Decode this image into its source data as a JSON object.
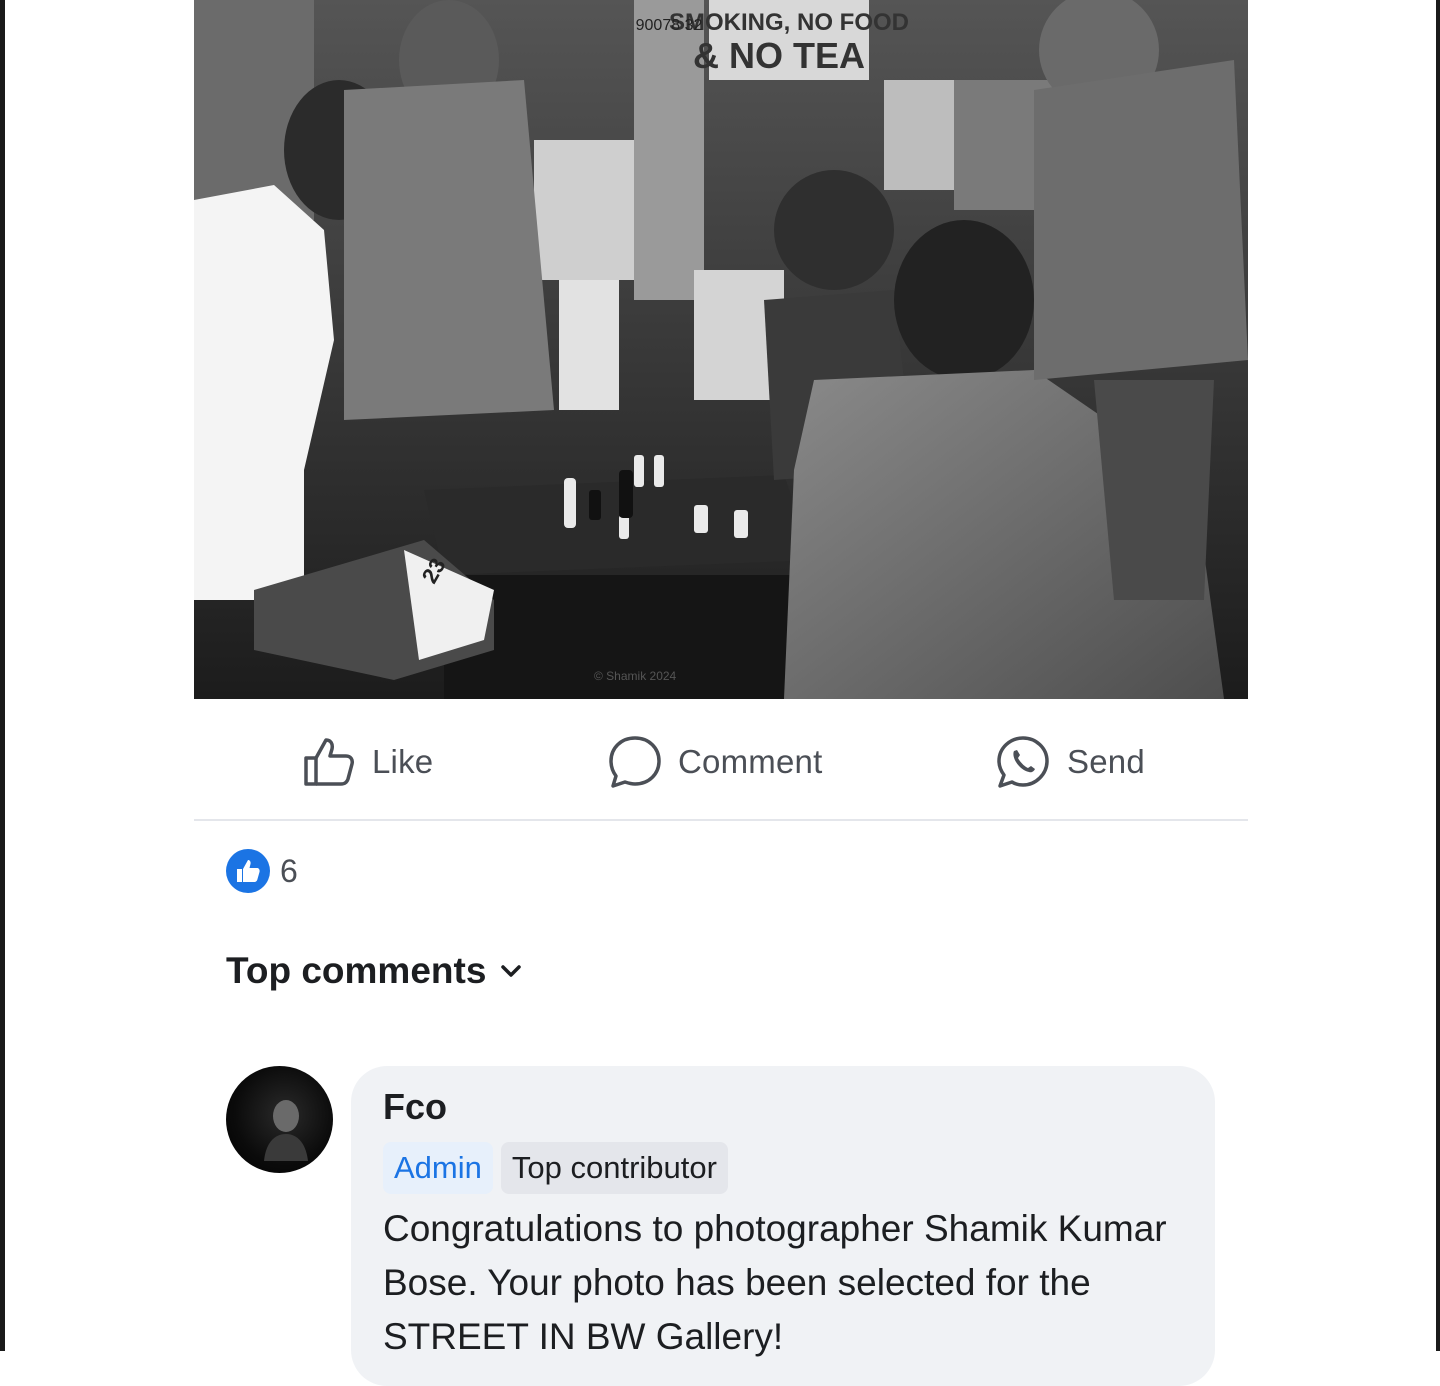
{
  "post": {
    "photo_alt": "Black and white street photo of men playing chess on a sidewalk",
    "photo_text": {
      "sign_line1": "SMOKING, NO FOOD",
      "sign_line2": "& NO TEA",
      "poster_number": "90078 32",
      "shorts_number": "23",
      "watermark": "© Shamik 2024"
    }
  },
  "actions": {
    "like_label": "Like",
    "comment_label": "Comment",
    "send_label": "Send"
  },
  "reactions": {
    "count": "6"
  },
  "comments_section": {
    "header": "Top comments"
  },
  "comment": {
    "author": "Fco",
    "badge_admin": "Admin",
    "badge_top": "Top contributor",
    "text": "Congratulations to photographer Shamik Kumar Bose. Your photo has been selected for the STREET IN BW Gallery!"
  },
  "colors": {
    "accent": "#1b74e4",
    "bubble": "#f0f2f5",
    "divider": "#e4e6eb",
    "action_text": "#4b4f56"
  }
}
